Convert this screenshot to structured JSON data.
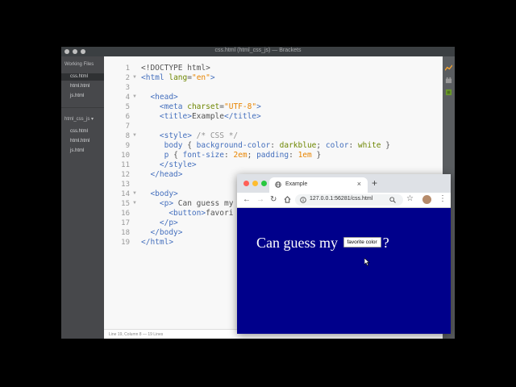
{
  "window": {
    "title": "css.html (html_css_js) — Brackets"
  },
  "sidebar": {
    "working_files_label": "Working Files",
    "working_files": [
      "css.html",
      "html.html",
      "js.html"
    ],
    "project_label": "html_css_js",
    "project_files": [
      "css.html",
      "html.html",
      "js.html"
    ]
  },
  "editor": {
    "line_numbers": [
      "1",
      "2",
      "3",
      "4",
      "5",
      "6",
      "7",
      "8",
      "9",
      "10",
      "11",
      "12",
      "13",
      "14",
      "15",
      "16",
      "17",
      "18",
      "19"
    ]
  },
  "status_bar": {
    "text": "Line 19, Column 8 — 19 Lines"
  },
  "browser": {
    "tab_title": "Example",
    "url": "127.0.0.1:56281/css.html",
    "page_text_before": "Can guess my",
    "button_label": "favorite color",
    "page_text_after": "?",
    "background_color": "#00008b"
  },
  "colors": {
    "accent": "#446fbd",
    "brackets_dark": "#47484b"
  }
}
